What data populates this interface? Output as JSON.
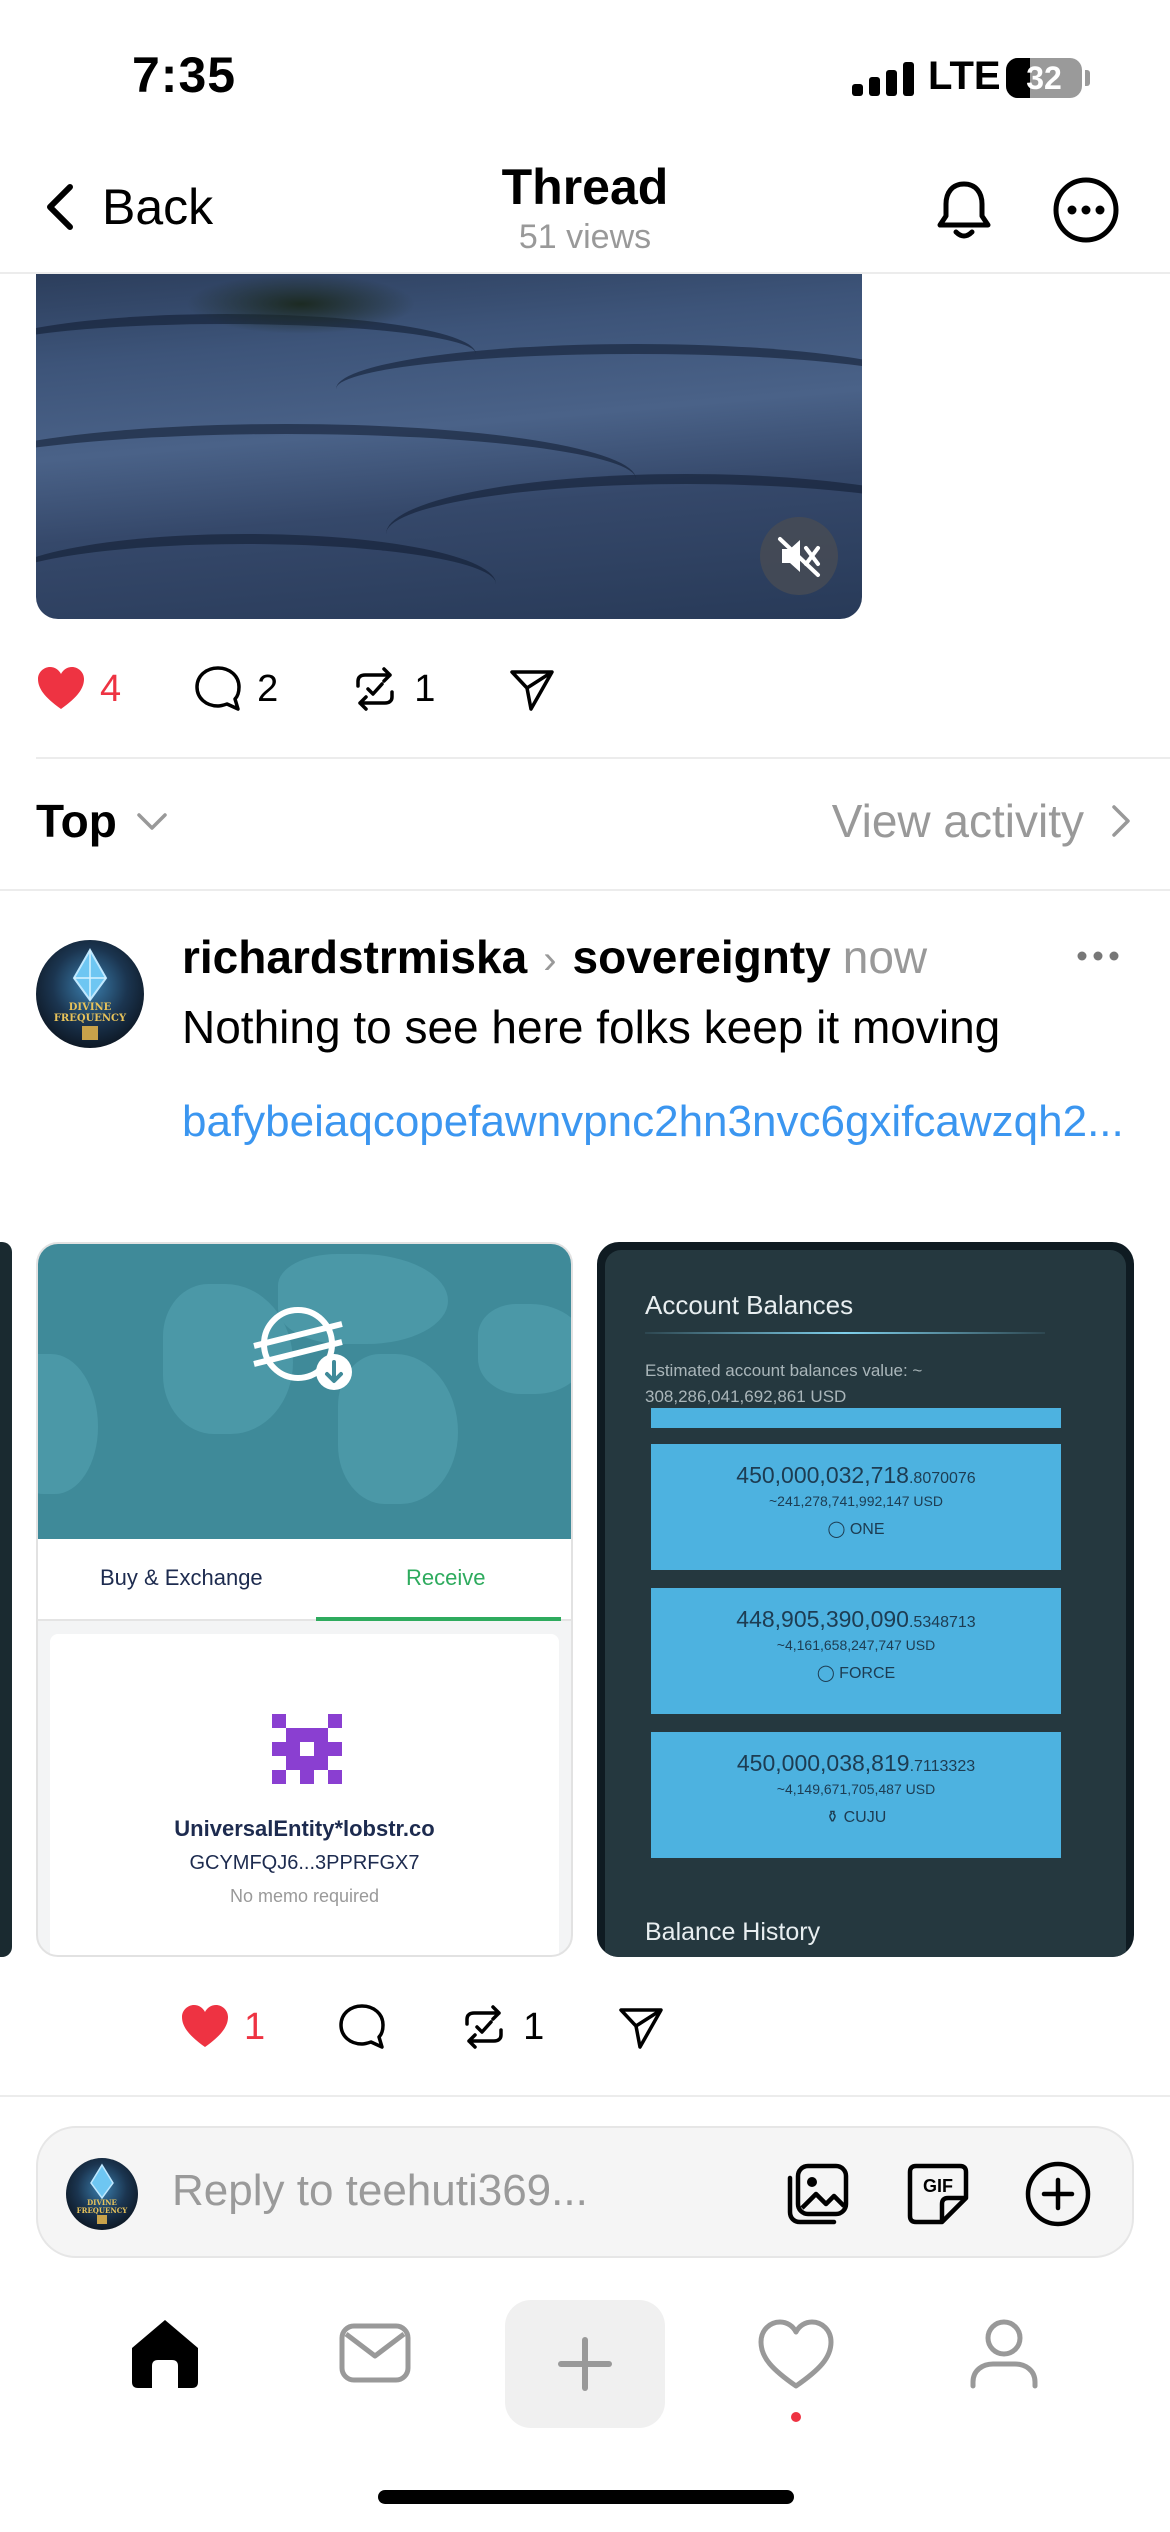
{
  "status_bar": {
    "time": "7:35",
    "network": "LTE",
    "battery": "32"
  },
  "header": {
    "back_label": "Back",
    "title": "Thread",
    "views": "51 views"
  },
  "original_post": {
    "actions": {
      "likes": "4",
      "replies": "2",
      "reposts": "1"
    }
  },
  "sort": {
    "label": "Top",
    "view_activity": "View activity"
  },
  "reply_post": {
    "username": "richardstrmiska",
    "community": "sovereignty",
    "time": "now",
    "text": "Nothing to see here folks keep it moving",
    "link": "bafybeiaqcopefawnvpnc2hn3nvc6gxifcawzqh2...",
    "media_left": {
      "tab_buy": "Buy & Exchange",
      "tab_receive": "Receive",
      "name": "UniversalEntity*lobstr.co",
      "address": "GCYMFQJ6...3PPRFGX7",
      "memo": "No memo required"
    },
    "media_right": {
      "title": "Account Balances",
      "estimate_label": "Estimated account balances value: ~",
      "estimate_value": "308,286,041,692,861 USD",
      "balances": [
        {
          "amount": "450,000,032,718",
          "decimals": ".8070076",
          "usd": "~241,278,741,992,147 USD",
          "token": "ONE"
        },
        {
          "amount": "448,905,390,090",
          "decimals": ".5348713",
          "usd": "~4,161,658,247,747 USD",
          "token": "FORCE"
        },
        {
          "amount": "450,000,038,819",
          "decimals": ".7113323",
          "usd": "~4,149,671,705,487 USD",
          "token": "CUJU"
        }
      ],
      "history_label": "Balance History"
    },
    "actions": {
      "likes": "1",
      "reposts": "1"
    }
  },
  "avatar_text": {
    "line1": "DIVINE",
    "line2": "FREQUENCY"
  },
  "reply_bar": {
    "placeholder": "Reply to teehuti369..."
  },
  "colors": {
    "accent_blue": "#3b96f0",
    "like_red": "#ee3342",
    "muted": "#999999"
  }
}
